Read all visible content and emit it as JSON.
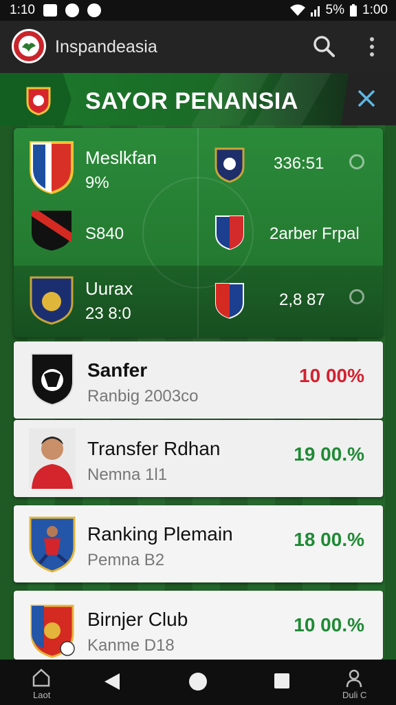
{
  "status": {
    "time": "1:10",
    "battery": "5%",
    "clock": "1:00"
  },
  "app": {
    "name": "Inspandeasia"
  },
  "banner": {
    "title": "SAYOR PENANSIA"
  },
  "matches": [
    {
      "left_name": "Meslkfan",
      "left_value": "9%",
      "right_value": "336:51"
    },
    {
      "left_value": "S840",
      "right_value": "2arber Frpal"
    },
    {
      "left_name": "Uurax",
      "left_value": "23 8:0",
      "right_value": "2,8 87"
    }
  ],
  "list": [
    {
      "title": "Sanfer",
      "subtitle": "Ranbig 2003co",
      "percent": "10 00%",
      "percent_color": "#d32230"
    },
    {
      "title": "Transfer Rdhan",
      "subtitle": "Nemna 1l1",
      "percent": "19 00.%",
      "percent_color": "#1f8a35"
    },
    {
      "title": "Ranking Plemain",
      "subtitle": "Pemna B2",
      "percent": "18 00.%",
      "percent_color": "#1f8a35"
    },
    {
      "title": "Birnjer Club",
      "subtitle": "Kanme D18",
      "percent": "10 00.%",
      "percent_color": "#1f8a35"
    }
  ],
  "nav": {
    "left_label": "Laot",
    "right_label": "Duli C"
  },
  "colors": {
    "green": "#1f8a35",
    "red": "#d32230",
    "accent_blue": "#5ab8e6"
  }
}
